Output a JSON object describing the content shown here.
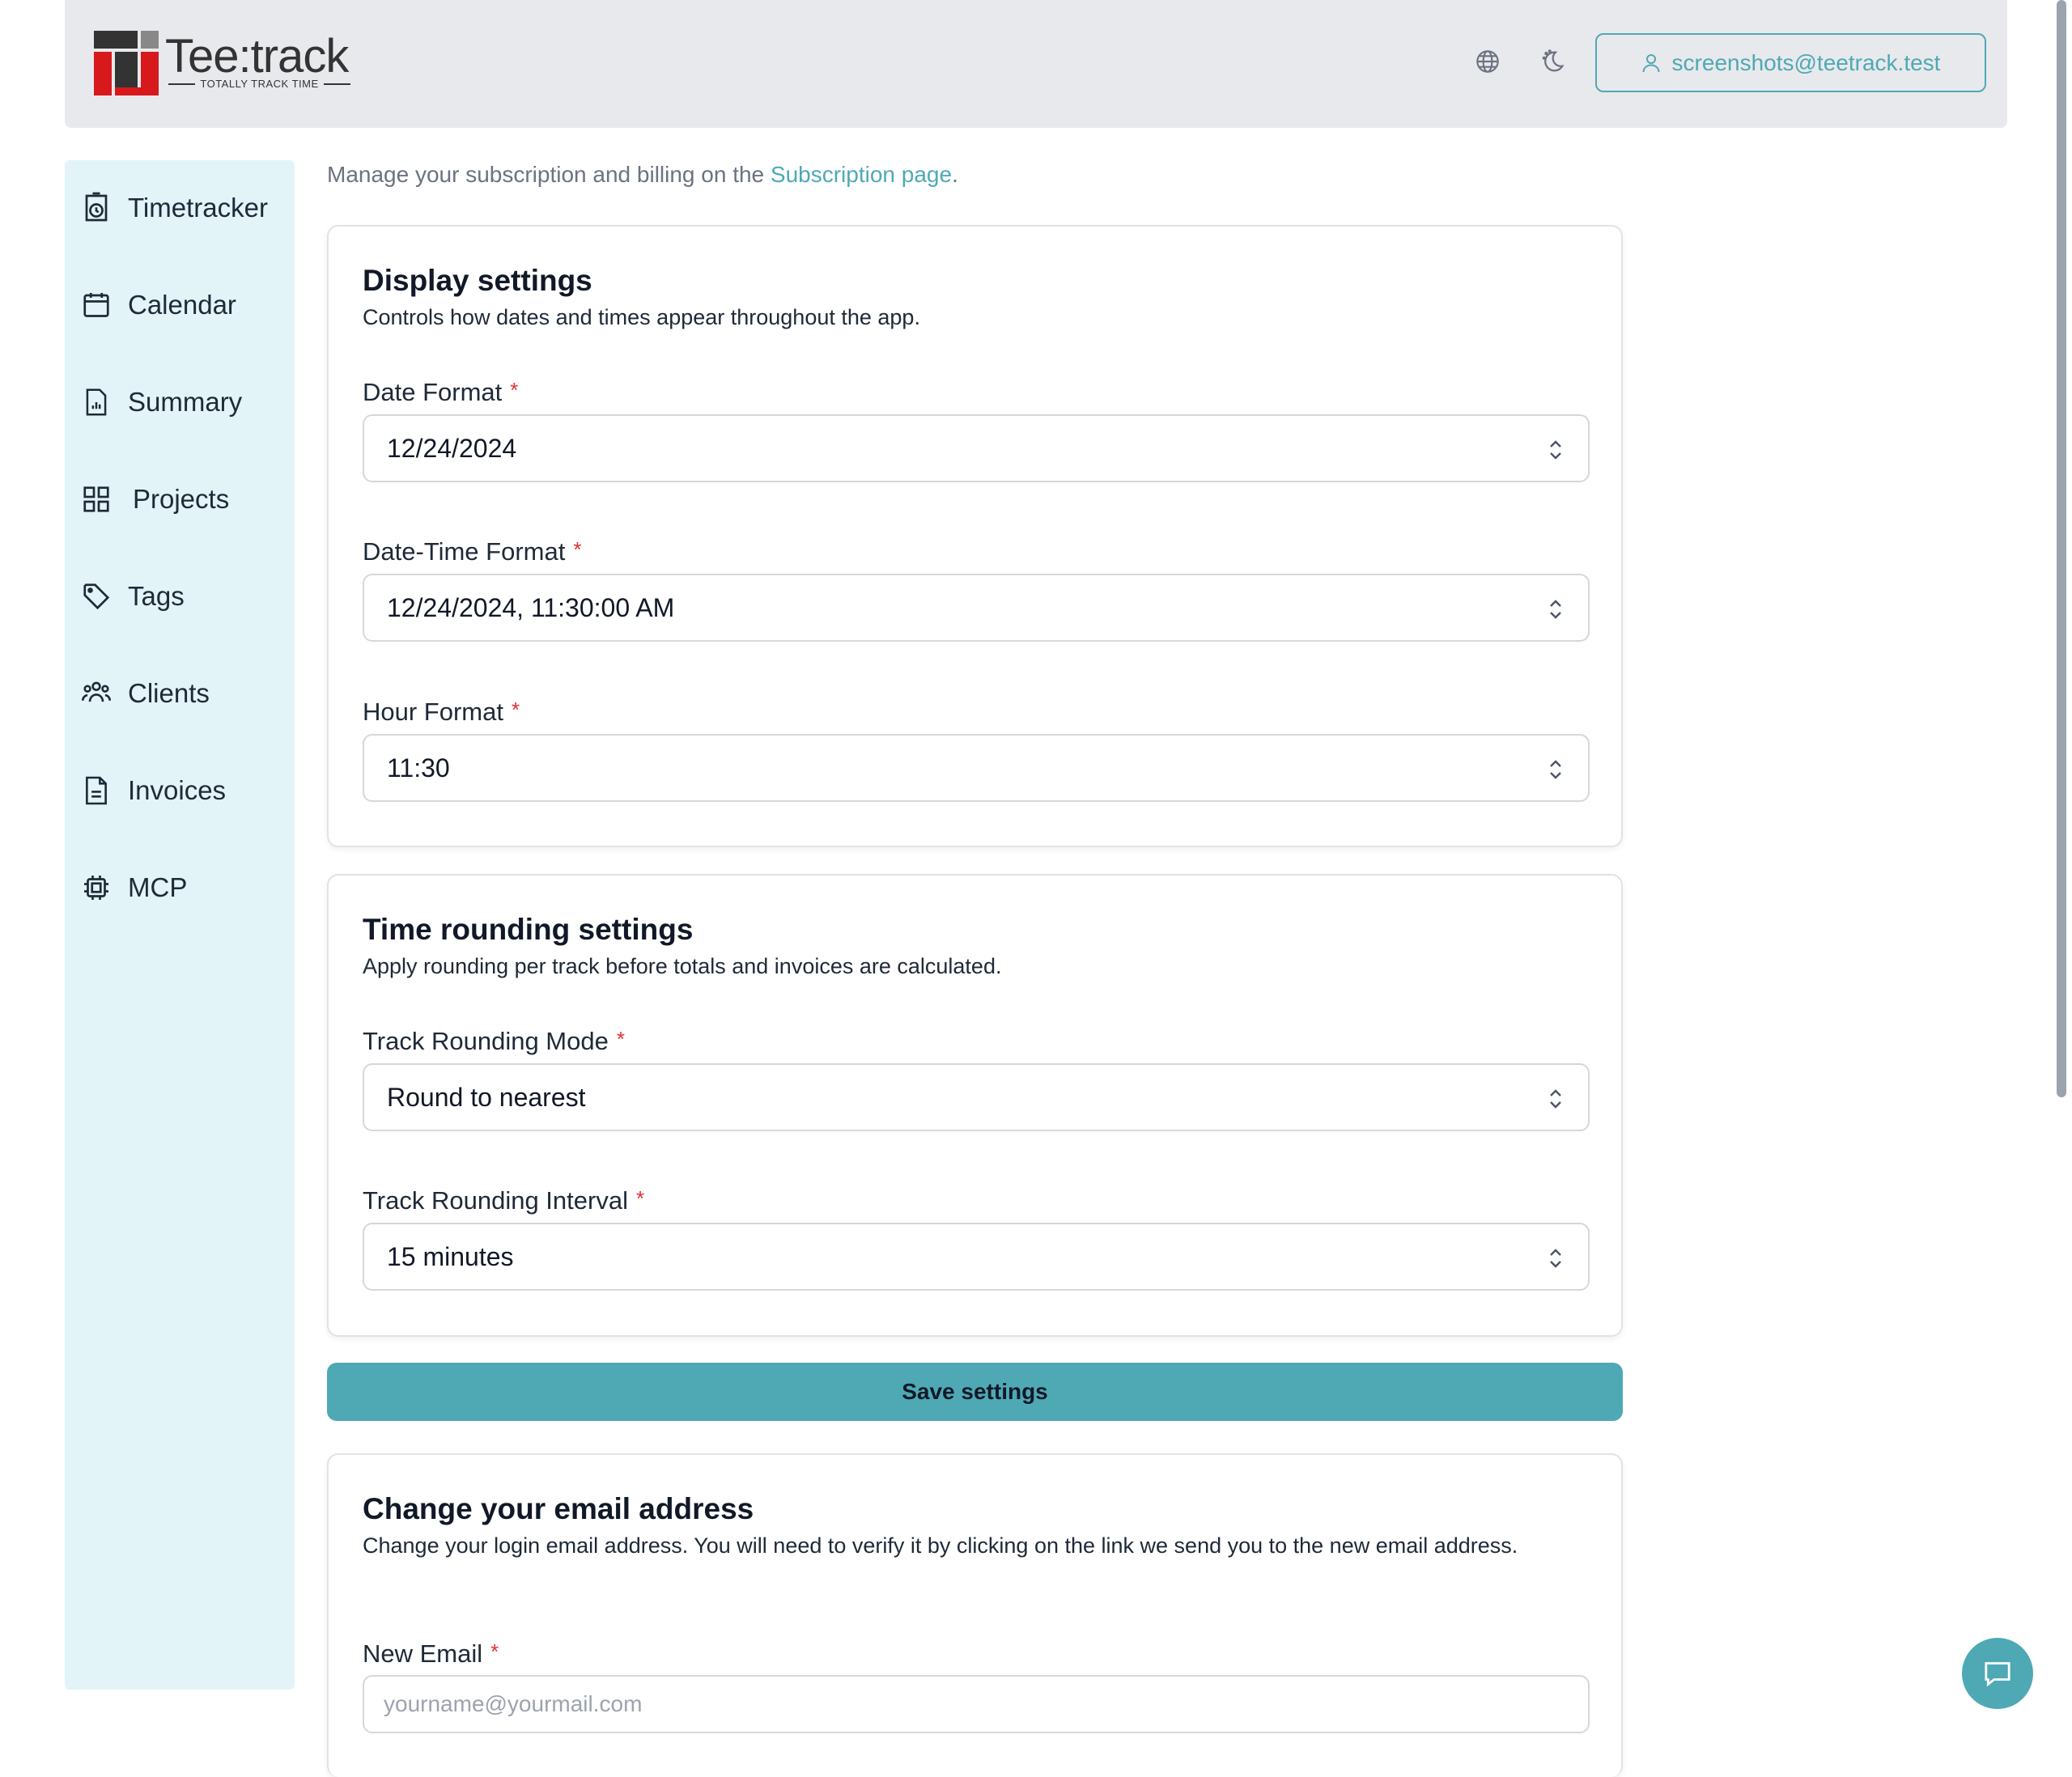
{
  "header": {
    "logo_text": "Tee:track",
    "logo_tagline": "TOTALLY TRACK TIME",
    "user_email": "screenshots@teetrack.test",
    "icons": [
      "globe-icon",
      "theme-moon-icon",
      "user-icon"
    ]
  },
  "sidebar": {
    "items": [
      {
        "label": "Timetracker",
        "icon": "stopwatch-icon"
      },
      {
        "label": "Calendar",
        "icon": "calendar-icon"
      },
      {
        "label": "Summary",
        "icon": "chart-file-icon"
      },
      {
        "label": "Projects",
        "icon": "grid-icon"
      },
      {
        "label": "Tags",
        "icon": "tag-icon"
      },
      {
        "label": "Clients",
        "icon": "users-icon"
      },
      {
        "label": "Invoices",
        "icon": "file-text-icon"
      },
      {
        "label": "MCP",
        "icon": "cpu-icon"
      }
    ]
  },
  "intro": {
    "text": "Manage your subscription and billing on the ",
    "link": "Subscription page",
    "suffix": "."
  },
  "display_settings": {
    "title": "Display settings",
    "description": "Controls how dates and times appear throughout the app.",
    "date_format_label": "Date Format",
    "date_format_value": "12/24/2024",
    "datetime_format_label": "Date-Time Format",
    "datetime_format_value": "12/24/2024, 11:30:00 AM",
    "hour_format_label": "Hour Format",
    "hour_format_value": "11:30",
    "required_mark": "*"
  },
  "rounding_settings": {
    "title": "Time rounding settings",
    "description": "Apply rounding per track before totals and invoices are calculated.",
    "mode_label": "Track Rounding Mode",
    "mode_value": "Round to nearest",
    "interval_label": "Track Rounding Interval",
    "interval_value": "15 minutes"
  },
  "save_button": "Save settings",
  "email_change": {
    "title": "Change your email address",
    "description": "Change your login email address. You will need to verify it by clicking on the link we send you to the new email address.",
    "new_email_label": "New Email",
    "new_email_placeholder": "yourname@yourmail.com"
  },
  "colors": {
    "accent": "#4ea9b5",
    "sidebar_bg": "#e2f4f8",
    "header_bg": "#e8e9ec",
    "required": "#e03131"
  }
}
